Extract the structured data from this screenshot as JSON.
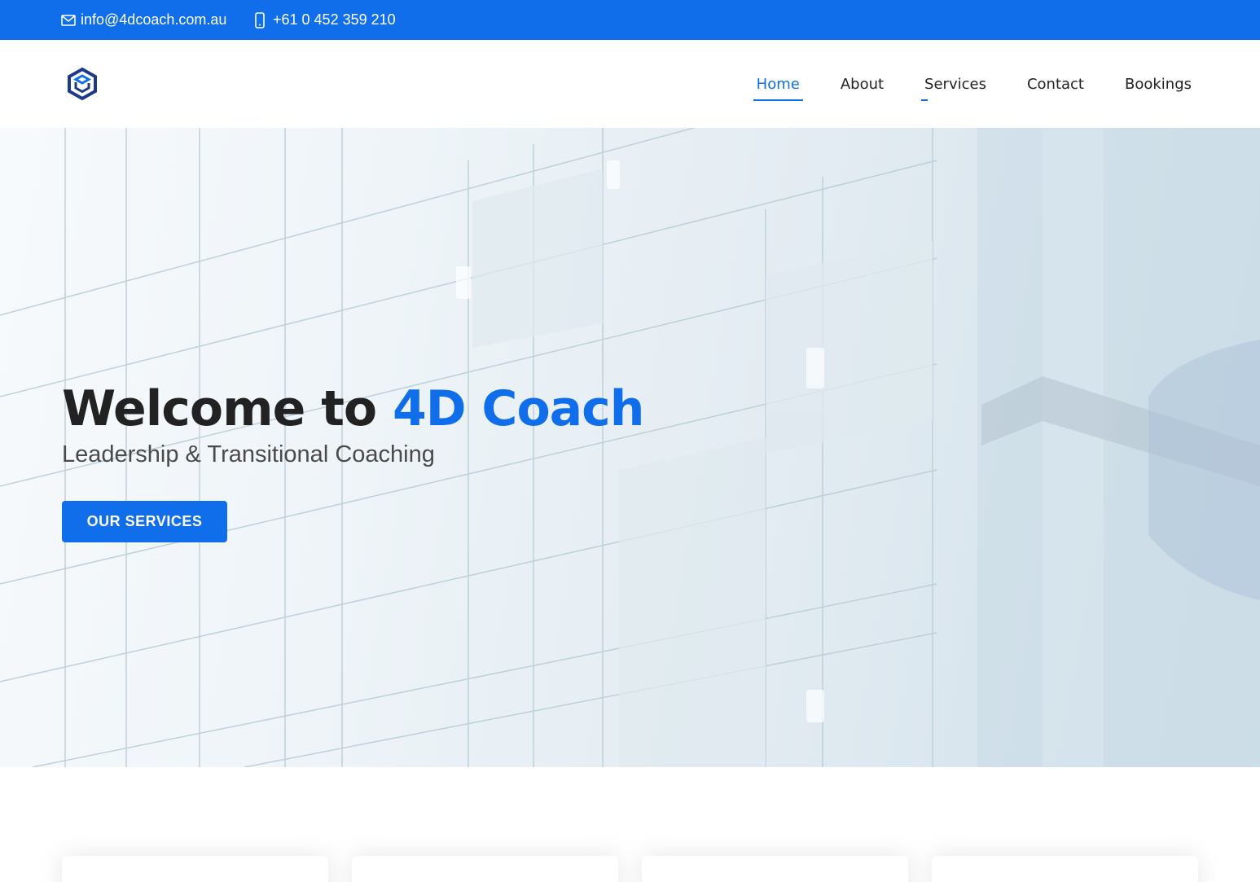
{
  "topbar": {
    "email": "info@4dcoach.com.au",
    "phone": "+61 0 452 359 210",
    "email_icon": "envelope-icon",
    "phone_icon": "phone-icon"
  },
  "header": {
    "logo_icon": "hexagon-logo-icon",
    "nav": [
      {
        "label": "Home",
        "active": true
      },
      {
        "label": "About",
        "active": false
      },
      {
        "label": "Services",
        "active": false
      },
      {
        "label": "Contact",
        "active": false
      },
      {
        "label": "Bookings",
        "active": false
      }
    ]
  },
  "hero": {
    "title_prefix": "Welcome to ",
    "title_accent": "4D Coach",
    "subtitle": "Leadership & Transitional Coaching",
    "button_label": "OUR SERVICES"
  },
  "colors": {
    "accent": "#106eea",
    "text_dark": "#222222",
    "text_muted": "#4a4a4a"
  }
}
